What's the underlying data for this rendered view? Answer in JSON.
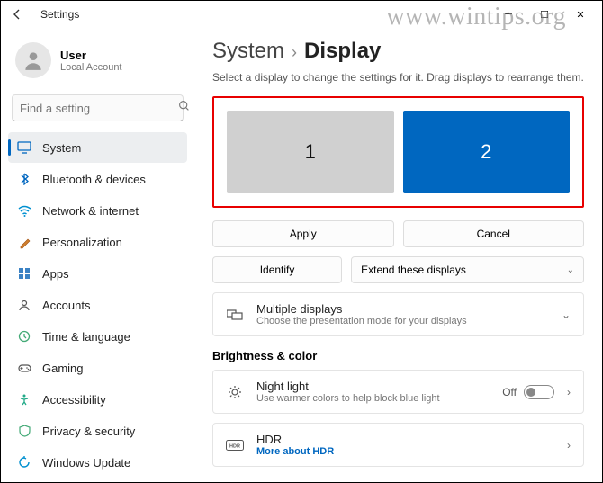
{
  "titlebar": {
    "app_title": "Settings"
  },
  "user": {
    "name": "User",
    "sub": "Local Account"
  },
  "search": {
    "placeholder": "Find a setting"
  },
  "nav": {
    "system": "System",
    "bluetooth": "Bluetooth & devices",
    "network": "Network & internet",
    "personalization": "Personalization",
    "apps": "Apps",
    "accounts": "Accounts",
    "time": "Time & language",
    "gaming": "Gaming",
    "accessibility": "Accessibility",
    "privacy": "Privacy & security",
    "update": "Windows Update"
  },
  "breadcrumb": {
    "system": "System",
    "display": "Display"
  },
  "desc": "Select a display to change the settings for it. Drag displays to rearrange them.",
  "monitors": {
    "m1": "1",
    "m2": "2"
  },
  "buttons": {
    "apply": "Apply",
    "cancel": "Cancel",
    "identify": "Identify",
    "mode": "Extend these displays"
  },
  "multi": {
    "title": "Multiple displays",
    "sub": "Choose the presentation mode for your displays"
  },
  "section_bc": "Brightness & color",
  "night": {
    "title": "Night light",
    "sub": "Use warmer colors to help block blue light",
    "state": "Off"
  },
  "hdr": {
    "title": "HDR",
    "link": "More about HDR"
  },
  "watermark": "www.wintips.org"
}
